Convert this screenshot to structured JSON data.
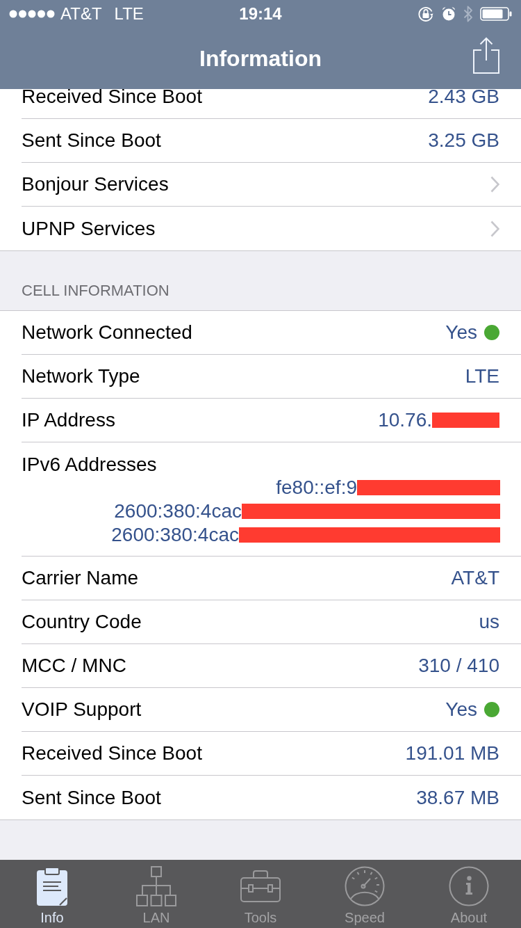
{
  "status_bar": {
    "carrier": "AT&T",
    "network": "LTE",
    "time": "19:14"
  },
  "nav_bar": {
    "title": "Information"
  },
  "traffic_rows": [
    {
      "kind": "value",
      "label": "Received Since Boot",
      "value": "2.43 GB"
    },
    {
      "kind": "value",
      "label": "Sent Since Boot",
      "value": "3.25 GB"
    },
    {
      "kind": "link",
      "label": "Bonjour Services"
    },
    {
      "kind": "link",
      "label": "UPNP Services"
    }
  ],
  "cell_section": {
    "header": "CELL INFORMATION",
    "rows": [
      {
        "kind": "status",
        "label": "Network Connected",
        "value": "Yes",
        "color": "#4aa834"
      },
      {
        "kind": "value",
        "label": "Network Type",
        "value": "LTE"
      },
      {
        "kind": "value",
        "label": "IP Address",
        "value": "10.76.",
        "redacted": true
      },
      {
        "kind": "list",
        "label": "IPv6 Addresses",
        "values": [
          {
            "text": "fe80::ef:9",
            "redacted": true
          },
          {
            "text": "2600:380:4cac",
            "redacted": true
          },
          {
            "text": "2600:380:4cac",
            "redacted": true
          }
        ]
      },
      {
        "kind": "value",
        "label": "Carrier Name",
        "value": "AT&T"
      },
      {
        "kind": "value",
        "label": "Country Code",
        "value": "us"
      },
      {
        "kind": "value",
        "label": "MCC / MNC",
        "value": "310 / 410"
      },
      {
        "kind": "status",
        "label": "VOIP Support",
        "value": "Yes",
        "color": "#4aa834"
      },
      {
        "kind": "value",
        "label": "Received Since Boot",
        "value": "191.01 MB"
      },
      {
        "kind": "value",
        "label": "Sent Since Boot",
        "value": "38.67 MB"
      }
    ]
  },
  "tab_bar": [
    {
      "label": "Info",
      "selected": true
    },
    {
      "label": "LAN",
      "selected": false
    },
    {
      "label": "Tools",
      "selected": false
    },
    {
      "label": "Speed",
      "selected": false
    },
    {
      "label": "About",
      "selected": false
    }
  ]
}
